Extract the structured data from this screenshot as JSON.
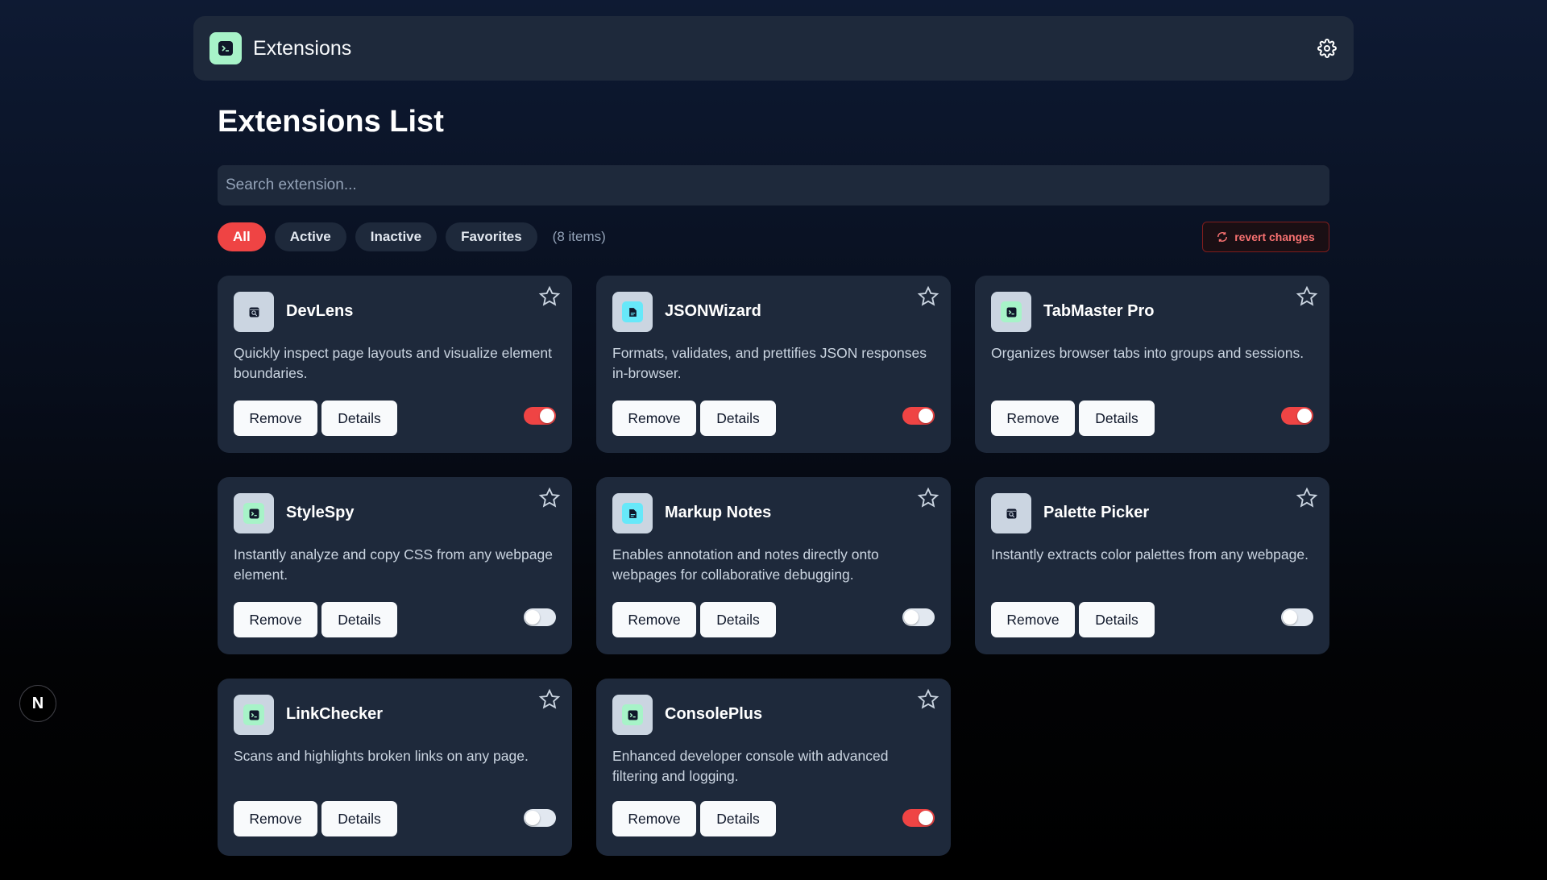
{
  "header": {
    "title": "Extensions",
    "logo_icon": "terminal-icon",
    "settings_icon": "gear-icon"
  },
  "main": {
    "title": "Extensions List",
    "search": {
      "placeholder": "Search extension...",
      "value": ""
    },
    "filters": [
      {
        "label": "All",
        "active": true
      },
      {
        "label": "Active",
        "active": false
      },
      {
        "label": "Inactive",
        "active": false
      },
      {
        "label": "Favorites",
        "active": false
      }
    ],
    "count_text": "(8 items)",
    "revert_label": "revert changes"
  },
  "colors": {
    "accent": "#ef4444",
    "card_bg": "#1e293b",
    "icon_green": "#a7f3c8",
    "icon_cyan": "#67e8f9",
    "icon_gray": "#cbd5e1"
  },
  "extensions": [
    {
      "name": "DevLens",
      "description": "Quickly inspect page layouts and visualize element boundaries.",
      "enabled": true,
      "icon": "inspect-icon",
      "icon_color": "#cbd5e1"
    },
    {
      "name": "JSONWizard",
      "description": "Formats, validates, and prettifies JSON responses in-browser.",
      "enabled": true,
      "icon": "document-icon",
      "icon_color": "#67e8f9"
    },
    {
      "name": "TabMaster Pro",
      "description": "Organizes browser tabs into groups and sessions.",
      "enabled": true,
      "icon": "terminal-icon",
      "icon_color": "#a7f3c8"
    },
    {
      "name": "StyleSpy",
      "description": "Instantly analyze and copy CSS from any webpage element.",
      "enabled": false,
      "icon": "terminal-icon",
      "icon_color": "#a7f3c8"
    },
    {
      "name": "Markup Notes",
      "description": "Enables annotation and notes directly onto webpages for collaborative debugging.",
      "enabled": false,
      "icon": "document-icon",
      "icon_color": "#67e8f9"
    },
    {
      "name": "Palette Picker",
      "description": "Instantly extracts color palettes from any webpage.",
      "enabled": false,
      "icon": "inspect-icon",
      "icon_color": "#cbd5e1"
    },
    {
      "name": "LinkChecker",
      "description": "Scans and highlights broken links on any page.",
      "enabled": false,
      "icon": "terminal-icon",
      "icon_color": "#a7f3c8"
    },
    {
      "name": "ConsolePlus",
      "description": "Enhanced developer console with advanced filtering and logging.",
      "enabled": true,
      "icon": "terminal-icon",
      "icon_color": "#a7f3c8"
    }
  ],
  "buttons": {
    "remove_label": "Remove",
    "details_label": "Details"
  },
  "framework_badge": {
    "label": "N"
  }
}
